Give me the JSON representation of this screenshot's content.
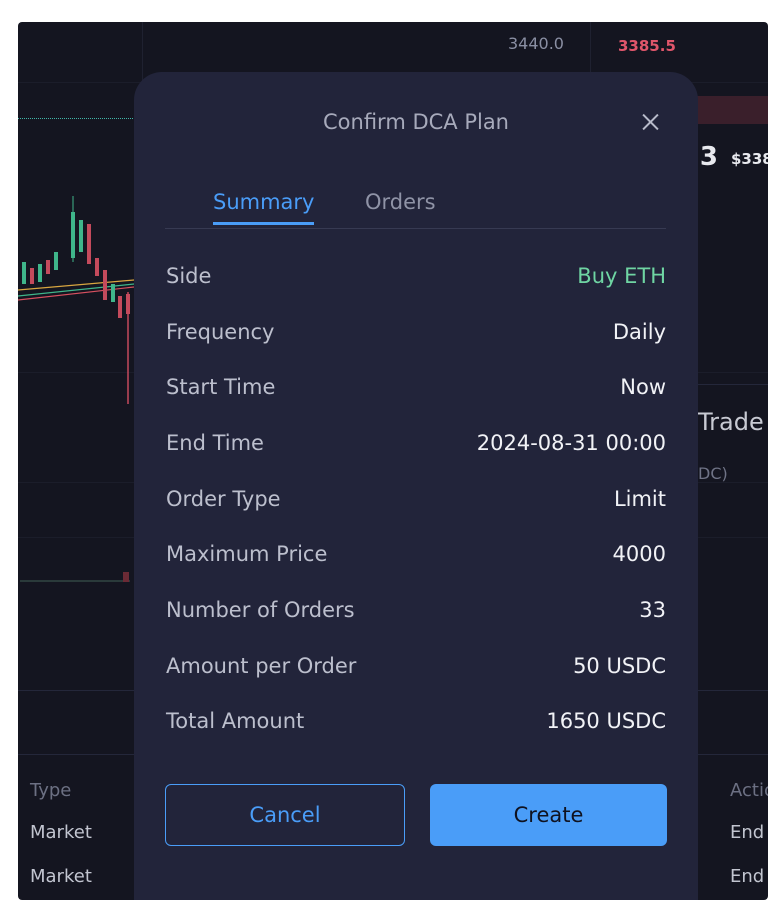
{
  "background": {
    "axis_price": "3440.0",
    "orderbook_top_price": "3385.5",
    "last_price_fragment": ".3",
    "last_price_usd_fragment": "$338",
    "trade_panel_title_fragment": "Trade",
    "trade_panel_sub_fragment": "DC)",
    "table": {
      "col_type_header": "Type",
      "col_action_header": "Actio",
      "rows": [
        {
          "type": "Market",
          "action": "End"
        },
        {
          "type": "Market",
          "action": "End"
        }
      ]
    }
  },
  "modal": {
    "title": "Confirm DCA Plan",
    "tabs": [
      "Summary",
      "Orders"
    ],
    "active_tab": "Summary",
    "rows": [
      {
        "label": "Side",
        "value": "Buy ETH"
      },
      {
        "label": "Frequency",
        "value": "Daily"
      },
      {
        "label": "Start Time",
        "value": "Now"
      },
      {
        "label": "End Time",
        "value": "2024-08-31 00:00"
      },
      {
        "label": "Order Type",
        "value": "Limit"
      },
      {
        "label": "Maximum Price",
        "value": "4000"
      },
      {
        "label": "Number of Orders",
        "value": "33"
      },
      {
        "label": "Amount per Order",
        "value": "50 USDC"
      },
      {
        "label": "Total Amount",
        "value": "1650 USDC"
      }
    ],
    "cancel_label": "Cancel",
    "create_label": "Create"
  },
  "colors": {
    "accent": "#4a9df8",
    "buy": "#6fd5a3",
    "sell": "#e0566b",
    "modal_bg": "#22243a",
    "page_bg": "#141520"
  }
}
